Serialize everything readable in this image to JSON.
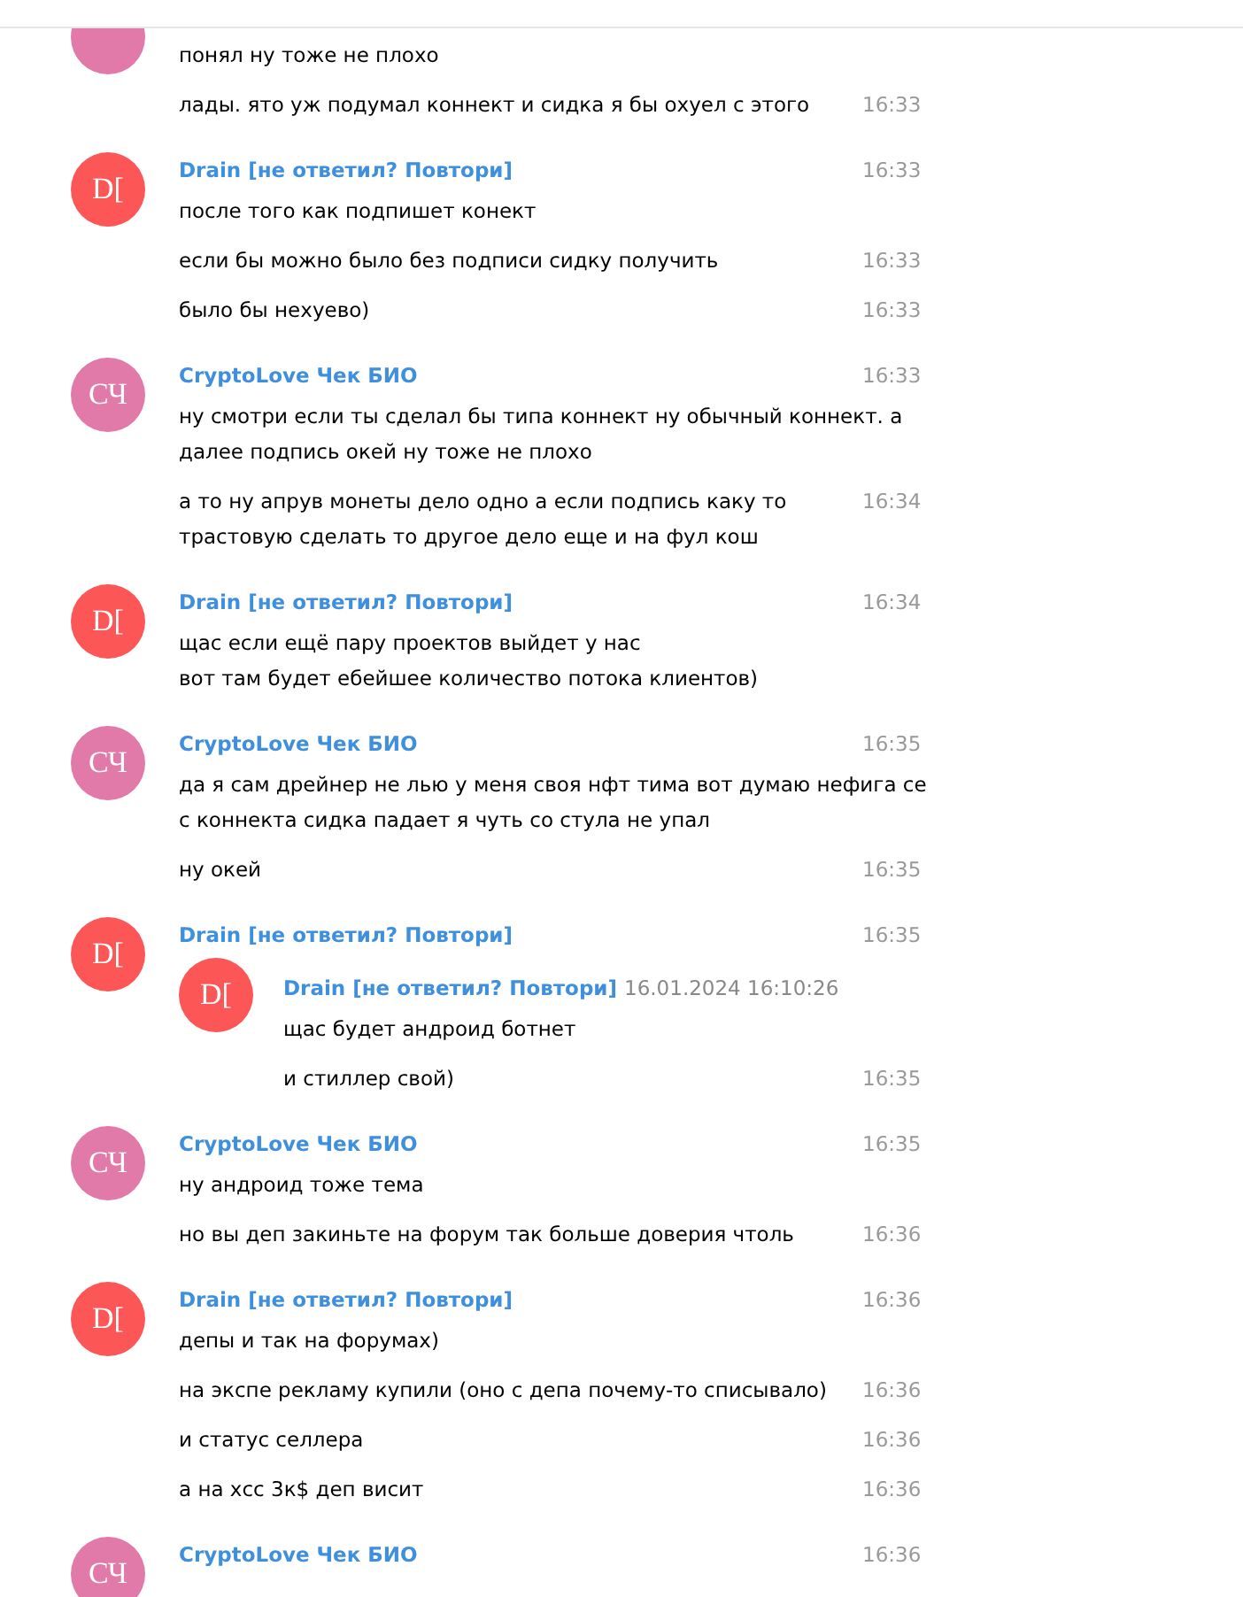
{
  "messages": [
    {
      "avatar": {
        "color": "#e27aa9"
      },
      "messages": [
        {
          "text": "понял ну тоже не плохо"
        },
        {
          "text": "лады. ято уж подумал коннект и сидка я бы охуел с этого",
          "time": "16:33"
        }
      ]
    },
    {
      "avatar": {
        "initials": "D[",
        "color": "#fc5656"
      },
      "name": "Drain [не ответил? Повтори]",
      "time": "16:33",
      "messages": [
        {
          "text": "после того как подпишет конект"
        },
        {
          "text": "если бы можно было без подписи сидку получить",
          "time": "16:33"
        },
        {
          "text": "было бы нехуево)",
          "time": "16:33"
        }
      ]
    },
    {
      "avatar": {
        "initials": "СЧ",
        "color": "#e27aa9"
      },
      "name": "CryptoLove Чек БИО",
      "time": "16:33",
      "messages": [
        {
          "text": "ну смотри если ты сделал бы типа коннект ну обычный коннект. а далее подпись окей ну тоже не плохо"
        },
        {
          "text": "а то ну апрув монеты дело одно а если подпись каку то трастовую сделать то другое дело еще и на фул кош",
          "time": "16:34"
        }
      ]
    },
    {
      "avatar": {
        "initials": "D[",
        "color": "#fc5656"
      },
      "name": "Drain [не ответил? Повтори]",
      "time": "16:34",
      "messages": [
        {
          "text": "щас если ещё пару проектов выйдет у нас\nвот там будет ебейшее количество потока клиентов)"
        }
      ]
    },
    {
      "avatar": {
        "initials": "СЧ",
        "color": "#e27aa9"
      },
      "name": "CryptoLove Чек БИО",
      "time": "16:35",
      "messages": [
        {
          "text": "да я сам дрейнер не лью у меня своя нфт тима вот думаю нефига се с коннекта сидка падает я чуть со стула не упал"
        },
        {
          "text": "ну окей",
          "time": "16:35"
        }
      ]
    },
    {
      "avatar": {
        "initials": "D[",
        "color": "#fc5656"
      },
      "name": "Drain [не ответил? Повтори]",
      "time": "16:35",
      "forwarded": {
        "avatar": {
          "initials": "D[",
          "color": "#fc5656"
        },
        "name": "Drain [не ответил? Повтори]",
        "date": "16.01.2024 16:10:26",
        "messages": [
          {
            "text": "щас будет андроид ботнет"
          },
          {
            "text": "и стиллер свой)",
            "time": "16:35"
          }
        ]
      }
    },
    {
      "avatar": {
        "initials": "СЧ",
        "color": "#e27aa9"
      },
      "name": "CryptoLove Чек БИО",
      "time": "16:35",
      "messages": [
        {
          "text": "ну андроид тоже тема"
        },
        {
          "text": "но вы деп закиньте на форум так больше доверия чтоль",
          "time": "16:36"
        }
      ]
    },
    {
      "avatar": {
        "initials": "D[",
        "color": "#fc5656"
      },
      "name": "Drain [не ответил? Повтори]",
      "time": "16:36",
      "messages": [
        {
          "text": "депы и так на форумах)"
        },
        {
          "text": "на экспе рекламу купили (оно с депа почему-то списывало)",
          "time": "16:36"
        },
        {
          "text": "и статус селлера",
          "time": "16:36"
        },
        {
          "text": "а на хсс 3к$ деп висит",
          "time": "16:36"
        }
      ]
    },
    {
      "avatar": {
        "initials": "СЧ",
        "color": "#e27aa9"
      },
      "name": "CryptoLove Чек БИО",
      "time": "16:36"
    }
  ]
}
